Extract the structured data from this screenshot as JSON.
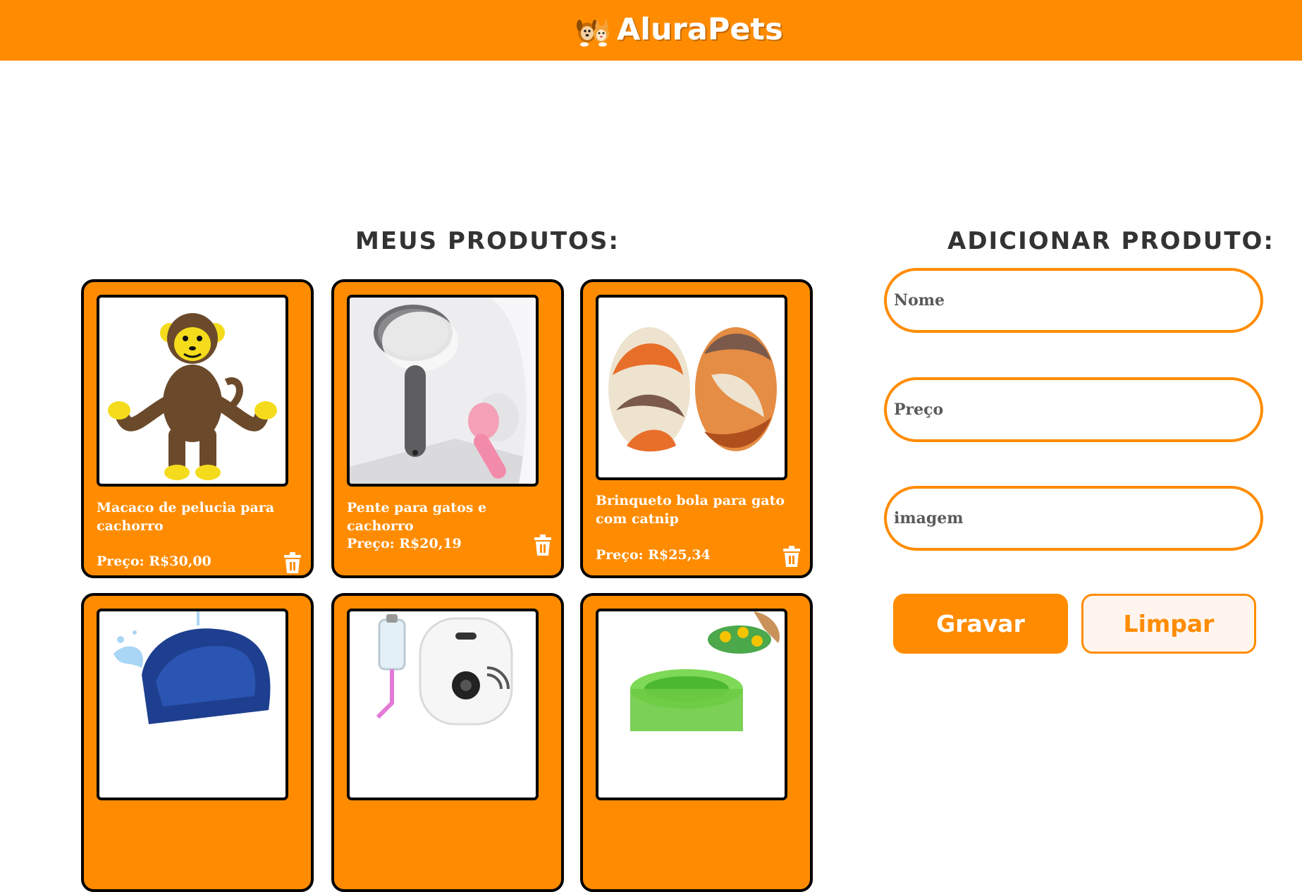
{
  "header": {
    "logo_text": "AluraPets",
    "logo_icon": "pets-logo-icon"
  },
  "products_section": {
    "title": "Meus Produtos:"
  },
  "products": [
    {
      "name": "Macaco de pelucia para cachorro",
      "price": "Preço: R$30,00",
      "image": "plush-monkey"
    },
    {
      "name": "Pente para gatos e cachorro",
      "price": "Preço: R$20,19",
      "image": "pet-brush"
    },
    {
      "name": "Brinqueto bola para gato com catnip",
      "price": "Preço: R$25,34",
      "image": "sisal-balls"
    },
    {
      "name": "",
      "price": "",
      "image": "water-fountain"
    },
    {
      "name": "",
      "price": "",
      "image": "automatic-feeder"
    },
    {
      "name": "",
      "price": "",
      "image": "puzzle-feeder"
    }
  ],
  "form": {
    "title": "Adicionar Produto:",
    "name_placeholder": "Nome",
    "price_placeholder": "Preço",
    "image_placeholder": "imagem",
    "save_label": "Gravar",
    "clear_label": "Limpar"
  },
  "colors": {
    "accent": "#FF8C00",
    "card_border": "#000000",
    "text": "#333333",
    "clear_bg": "#FFF5EE"
  }
}
